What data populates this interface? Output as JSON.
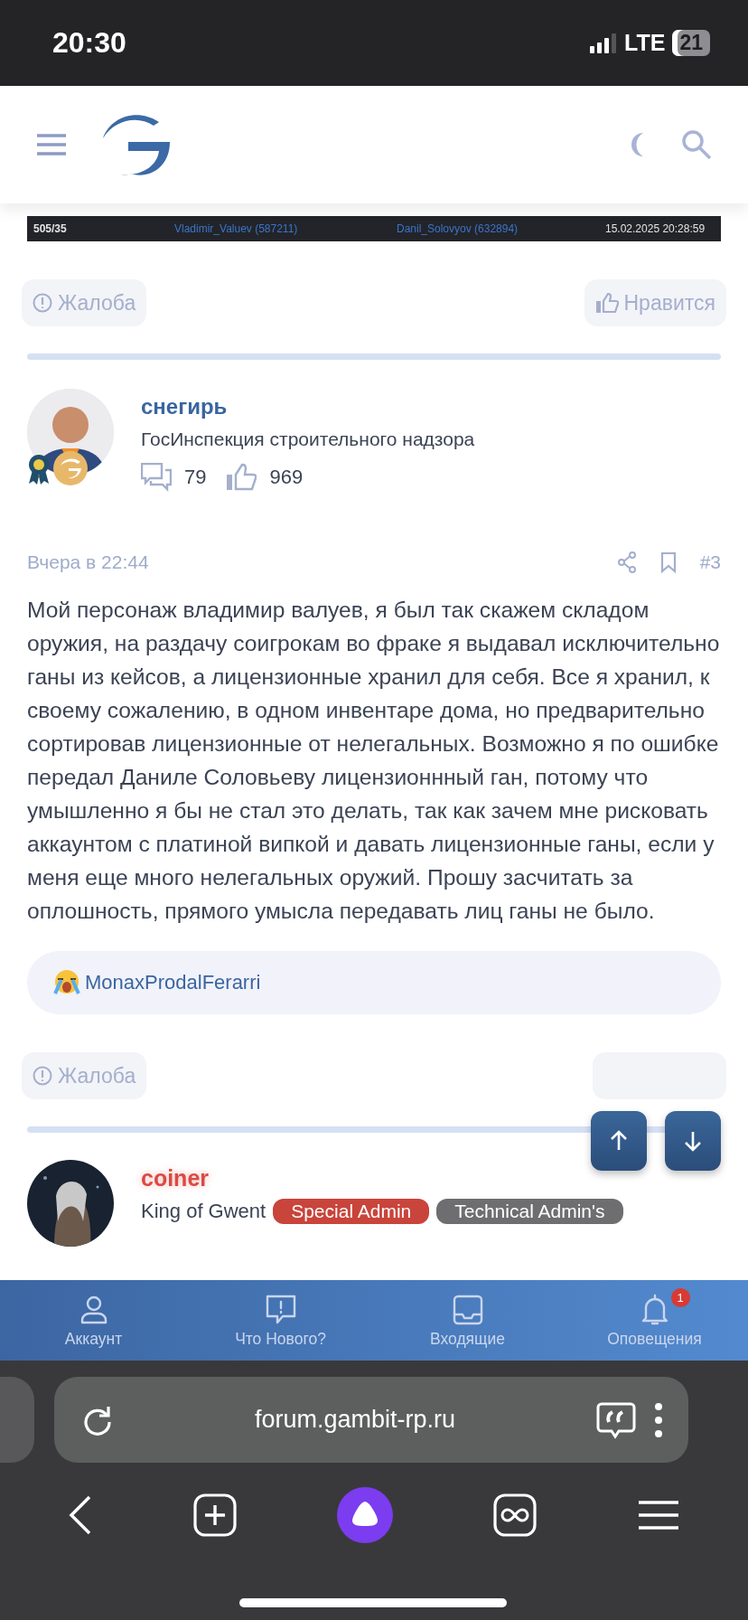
{
  "status_bar": {
    "time": "20:30",
    "network": "LTE",
    "battery": "21"
  },
  "log_row": {
    "cells": [
      {
        "text": "505/35",
        "kind": "text"
      },
      {
        "text": "Vladimir_Valuev (587211)",
        "kind": "link"
      },
      {
        "text": "Danil_Solovyov (632894)",
        "kind": "link"
      },
      {
        "text": "15.02.2025 20:28:59",
        "kind": "text"
      }
    ]
  },
  "previous_post_actions": {
    "report": "Жалоба",
    "like": "Нравится"
  },
  "post": {
    "author": {
      "name": "снегирь",
      "title": "ГосИнспекция строительного надзора",
      "messages": "79",
      "likes": "969"
    },
    "date": "Вчера в 22:44",
    "number": "#3",
    "body": "Мой персонаж владимир валуев, я был так скажем складом оружия, на раздачу соигрокам во фраке я выдавал исключительно ганы из кейсов, а лицензионные хранил для себя. Все я хранил, к своему сожалению, в одном инвентаре дома, но предварительно сортировав лицензионные от нелегальных. Возможно я по ошибке передал Даниле Соловьеву лицензионнный ган, потому что умышленно я бы не стал это делать, так как зачем мне рисковать аккаунтом с платиной випкой и давать лицензионные ганы, если у меня еще много нелегальных оружий. Прошу засчитать за оплошность, прямого умысла передавать лиц ганы не было.",
    "reaction": {
      "user": "MonaxProdalFerarri"
    },
    "report": "Жалоба"
  },
  "next_post": {
    "author": {
      "name": "coiner",
      "title": "King of Gwent",
      "badges": [
        {
          "label": "Special Admin",
          "color": "#c9443b"
        },
        {
          "label": "Technical Admin's",
          "color": "#6e6e70"
        }
      ]
    }
  },
  "bottom_nav": [
    {
      "kind": "account",
      "label": "Аккаунт"
    },
    {
      "kind": "whats-new",
      "label": "Что Нового?"
    },
    {
      "kind": "inbox",
      "label": "Входящие"
    },
    {
      "kind": "alerts",
      "label": "Оповещения",
      "badge": "1"
    }
  ],
  "browser": {
    "url": "forum.gambit-rp.ru"
  }
}
